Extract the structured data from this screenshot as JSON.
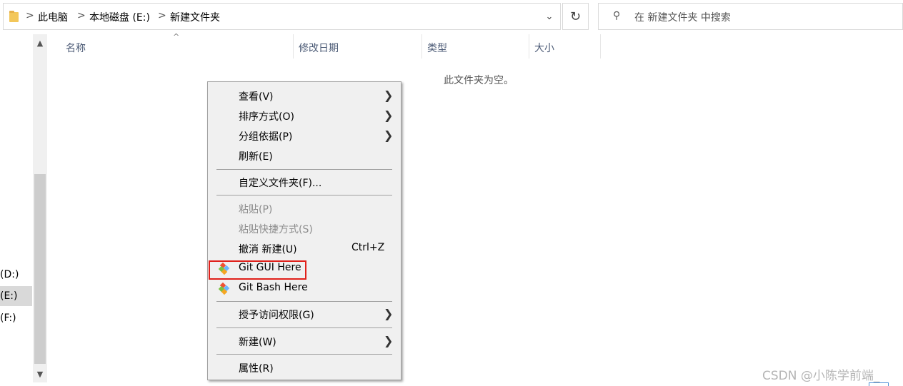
{
  "address": {
    "crumbs": [
      "此电脑",
      "本地磁盘 (E:)",
      "新建文件夹"
    ],
    "separator": ">",
    "dropdown_icon": "chevron-down-icon",
    "refresh_icon": "refresh-icon"
  },
  "search": {
    "placeholder": "在 新建文件夹 中搜索",
    "icon": "search-icon"
  },
  "nav": {
    "drives": [
      "(D:)",
      "(E:)",
      "(F:)"
    ],
    "selected": "(E:)"
  },
  "columns": [
    "名称",
    "修改日期",
    "类型",
    "大小"
  ],
  "empty_text": "此文件夹为空。",
  "context_menu": {
    "items": [
      {
        "label": "查看(V)",
        "submenu": true
      },
      {
        "label": "排序方式(O)",
        "submenu": true
      },
      {
        "label": "分组依据(P)",
        "submenu": true
      },
      {
        "label": "刷新(E)"
      },
      {
        "label": "自定义文件夹(F)..."
      },
      {
        "label": "粘贴(P)",
        "disabled": true
      },
      {
        "label": "粘贴快捷方式(S)",
        "disabled": true
      },
      {
        "label": "撤消 新建(U)",
        "shortcut": "Ctrl+Z"
      },
      {
        "label": "Git GUI Here",
        "icon": "git-icon",
        "highlighted": true
      },
      {
        "label": "Git Bash Here",
        "icon": "git-icon"
      },
      {
        "label": "授予访问权限(G)",
        "submenu": true
      },
      {
        "label": "新建(W)",
        "submenu": true
      },
      {
        "label": "属性(R)"
      }
    ]
  },
  "watermark": "CSDN @小陈学前端_",
  "colors": {
    "highlight_border": "#e0201a",
    "menu_bg": "#f0f0f0"
  }
}
